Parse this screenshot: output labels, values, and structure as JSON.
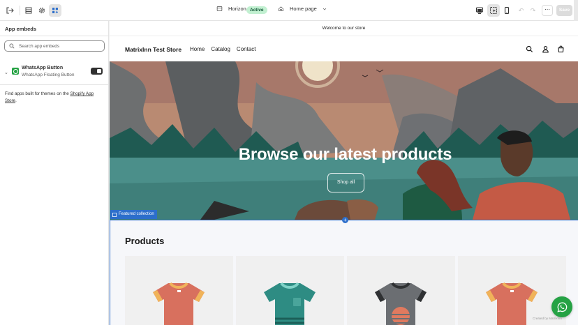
{
  "topbar": {
    "theme_name": "Horizon",
    "theme_status": "Active",
    "page_selector": "Home page",
    "save_label": "Save",
    "colors": {
      "active_badge_bg": "#c2f0d1",
      "active_badge_text": "#0c5132"
    }
  },
  "sidebar": {
    "title": "App embeds",
    "search_placeholder": "Search app embeds",
    "embeds": [
      {
        "name": "WhatsApp Button",
        "subtitle": "WhatsApp Floating Button",
        "enabled": true,
        "icon": "whatsapp-app-icon"
      }
    ],
    "find_text_prefix": "Find apps built for themes on the ",
    "find_link": "Shopify App Store",
    "find_text_suffix": "."
  },
  "preview": {
    "announcement": "Welcome to our store",
    "store_name": "MatrixInn Test Store",
    "nav": [
      "Home",
      "Catalog",
      "Contact"
    ],
    "hero_title": "Browse our latest products",
    "hero_button": "Shop all",
    "section_label": "Featured collection",
    "products_heading": "Products",
    "credit": "Created by MatrixInn",
    "product_colors": [
      "#d8705e",
      "#2e8c83",
      "#6b6e72",
      "#d8705e"
    ],
    "accent": "#2c6ecb"
  }
}
